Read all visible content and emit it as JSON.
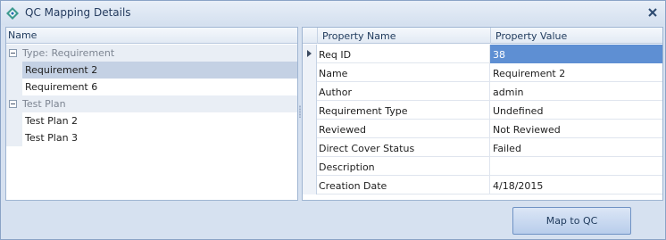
{
  "window": {
    "title": "QC Mapping Details",
    "icon": "diamond-logo-icon",
    "close_icon": "close-icon"
  },
  "tree": {
    "header": "Name",
    "groups": [
      {
        "label": "Type: Requirement",
        "items": [
          "Requirement 2",
          "Requirement 6"
        ]
      },
      {
        "label": "Test Plan",
        "items": [
          "Test Plan 2",
          "Test Plan 3"
        ]
      }
    ],
    "selected": "Requirement 2"
  },
  "grid": {
    "columns": [
      "Property Name",
      "Property Value"
    ],
    "rows": [
      {
        "name": "Req ID",
        "value": "38"
      },
      {
        "name": "Name",
        "value": "Requirement 2"
      },
      {
        "name": "Author",
        "value": "admin"
      },
      {
        "name": "Requirement Type",
        "value": "Undefined"
      },
      {
        "name": "Reviewed",
        "value": "Not Reviewed"
      },
      {
        "name": "Direct Cover Status",
        "value": "Failed"
      },
      {
        "name": "Description",
        "value": ""
      },
      {
        "name": "Creation Date",
        "value": "4/18/2015"
      }
    ]
  },
  "actions": {
    "map_label": "Map to QC"
  },
  "colors": {
    "accent": "#5e8fd3",
    "selection": "#c4d1e4",
    "frame": "#d6e1f0"
  }
}
